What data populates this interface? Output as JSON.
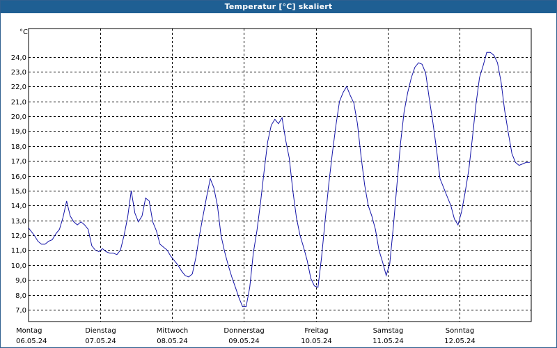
{
  "window": {
    "title": "Temperatur [°C] skaliert"
  },
  "colors": {
    "titlebar": "#1f5f93",
    "line": "#1414a8",
    "grid": "#000000"
  },
  "chart_data": {
    "type": "line",
    "title": "Temperatur [°C] skaliert",
    "xlabel": "",
    "ylabel": "°C",
    "ylim": [
      6.2,
      25.9
    ],
    "yticks": [
      7.0,
      8.0,
      9.0,
      10.0,
      11.0,
      12.0,
      13.0,
      14.0,
      15.0,
      16.0,
      17.0,
      18.0,
      19.0,
      20.0,
      21.0,
      22.0,
      23.0,
      24.0
    ],
    "ytick_labels": [
      "7,0",
      "8,0",
      "9,0",
      "10,0",
      "11,0",
      "12,0",
      "13,0",
      "14,0",
      "15,0",
      "16,0",
      "17,0",
      "18,0",
      "19,0",
      "20,0",
      "21,0",
      "22,0",
      "23,0",
      "24,0"
    ],
    "grid": true,
    "x_start_date": "2024-05-06",
    "x_end_day": 7.0,
    "x_axis": [
      {
        "day": "Montag",
        "date": "06.05.24"
      },
      {
        "day": "Dienstag",
        "date": "07.05.24"
      },
      {
        "day": "Mittwoch",
        "date": "08.05.24"
      },
      {
        "day": "Donnerstag",
        "date": "09.05.24"
      },
      {
        "day": "Freitag",
        "date": "10.05.24"
      },
      {
        "day": "Samstag",
        "date": "11.05.24"
      },
      {
        "day": "Sonntag",
        "date": "12.05.24"
      }
    ],
    "series": [
      {
        "x": [
          0.0,
          0.03,
          0.08,
          0.13,
          0.18,
          0.23,
          0.28,
          0.33,
          0.38,
          0.43,
          0.48,
          0.53,
          0.58,
          0.63,
          0.68,
          0.73,
          0.78,
          0.83,
          0.88,
          0.93,
          0.98,
          1.03,
          1.08,
          1.13,
          1.18,
          1.23,
          1.28,
          1.33,
          1.38,
          1.43,
          1.48,
          1.53,
          1.58,
          1.63,
          1.68,
          1.73,
          1.78,
          1.83,
          1.88,
          1.93,
          1.98,
          2.03,
          2.08,
          2.13,
          2.18,
          2.23,
          2.28,
          2.33,
          2.38,
          2.43,
          2.48,
          2.53,
          2.58,
          2.63,
          2.68,
          2.73,
          2.78,
          2.83,
          2.88,
          2.93,
          2.98,
          3.03,
          3.08,
          3.13,
          3.18,
          3.23,
          3.28,
          3.33,
          3.38,
          3.43,
          3.48,
          3.53,
          3.58,
          3.63,
          3.68,
          3.73,
          3.78,
          3.83,
          3.88,
          3.93,
          3.98,
          4.03,
          4.08,
          4.13,
          4.18,
          4.23,
          4.28,
          4.33,
          4.38,
          4.43,
          4.48,
          4.53,
          4.58,
          4.63,
          4.68,
          4.73,
          4.78,
          4.83,
          4.88,
          4.93,
          4.98,
          5.03,
          5.08,
          5.13,
          5.18,
          5.23,
          5.28,
          5.33,
          5.38,
          5.43,
          5.48,
          5.53,
          5.58,
          5.63,
          5.68,
          5.73,
          5.78,
          5.83,
          5.88,
          5.93,
          5.98,
          6.03,
          6.08,
          6.13,
          6.18,
          6.23,
          6.28,
          6.33,
          6.38,
          6.43,
          6.48,
          6.53,
          6.58,
          6.63,
          6.68,
          6.73,
          6.78,
          6.83,
          6.88,
          6.93,
          6.98
        ],
        "y": [
          12.5,
          12.3,
          12.0,
          11.6,
          11.4,
          11.4,
          11.6,
          11.7,
          12.1,
          12.4,
          13.2,
          14.3,
          13.3,
          12.9,
          12.7,
          12.9,
          12.7,
          12.4,
          11.3,
          11.0,
          10.9,
          11.1,
          10.9,
          10.8,
          10.8,
          10.7,
          11.0,
          12.0,
          13.2,
          15.0,
          13.5,
          12.9,
          13.3,
          14.5,
          14.3,
          12.9,
          12.3,
          11.4,
          11.2,
          11.0,
          10.6,
          10.3,
          10.0,
          9.6,
          9.3,
          9.2,
          9.4,
          10.5,
          12.0,
          13.3,
          14.6,
          15.8,
          15.2,
          14.0,
          12.0,
          10.9,
          10.0,
          9.2,
          8.5,
          7.8,
          7.2,
          7.2,
          8.5,
          10.8,
          12.3,
          14.2,
          16.3,
          18.3,
          19.4,
          19.8,
          19.5,
          19.9,
          18.4,
          17.2,
          15.0,
          13.2,
          12.0,
          11.2,
          10.3,
          9.1,
          8.6,
          8.5,
          10.5,
          13.0,
          15.4,
          17.5,
          19.4,
          21.0,
          21.6,
          22.0,
          21.4,
          20.9,
          19.5,
          17.3,
          15.4,
          14.0,
          13.3,
          12.4,
          11.0,
          10.2,
          9.3,
          10.1,
          12.6,
          15.4,
          18.2,
          20.3,
          21.6,
          22.6,
          23.3,
          23.6,
          23.5,
          22.9,
          21.2,
          19.6,
          17.8,
          15.8,
          15.2,
          14.6,
          14.0,
          13.1,
          12.7,
          13.6,
          14.9,
          16.4,
          18.5,
          20.8,
          22.6,
          23.4,
          24.3,
          24.3,
          24.1,
          23.6,
          22.3,
          20.4,
          18.9,
          17.5,
          16.9,
          16.7,
          16.8,
          16.9,
          16.9
        ]
      }
    ]
  }
}
